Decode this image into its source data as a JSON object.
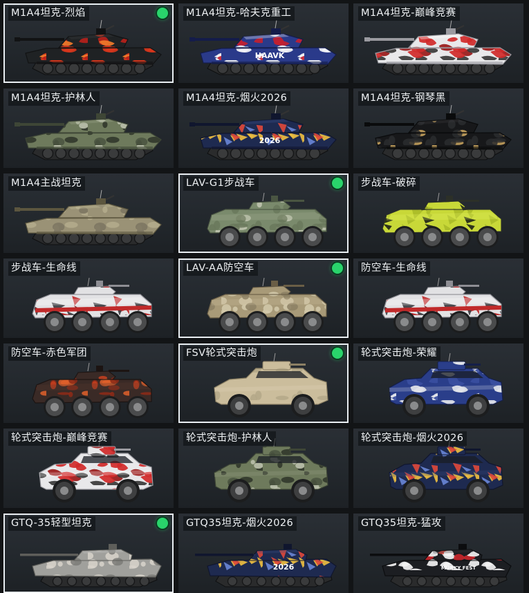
{
  "items": [
    {
      "label": "M1A4坦克-烈焰",
      "kind": "tank",
      "skin": "flame",
      "selected": true,
      "equipped": true
    },
    {
      "label": "M1A4坦克-哈夫克重工",
      "kind": "tank",
      "skin": "haavk",
      "selected": false,
      "equipped": false
    },
    {
      "label": "M1A4坦克-巅峰竞赛",
      "kind": "tank",
      "skin": "race",
      "selected": false,
      "equipped": false
    },
    {
      "label": "M1A4坦克-护林人",
      "kind": "tank",
      "skin": "forest",
      "selected": false,
      "equipped": false
    },
    {
      "label": "M1A4坦克-烟火2026",
      "kind": "tank",
      "skin": "fireworks",
      "selected": false,
      "equipped": false
    },
    {
      "label": "M1A4坦克-钢琴黑",
      "kind": "tank",
      "skin": "piano",
      "selected": false,
      "equipped": false
    },
    {
      "label": "M1A4主战坦克",
      "kind": "tank",
      "skin": "desert",
      "selected": false,
      "equipped": false
    },
    {
      "label": "LAV-G1步战车",
      "kind": "ifv",
      "skin": "green",
      "selected": true,
      "equipped": true
    },
    {
      "label": "步战车-破碎",
      "kind": "ifv",
      "skin": "shatter",
      "selected": false,
      "equipped": false
    },
    {
      "label": "步战车-生命线",
      "kind": "ifv",
      "skin": "lifeline",
      "selected": false,
      "equipped": false
    },
    {
      "label": "LAV-AA防空车",
      "kind": "ifv",
      "skin": "sand",
      "selected": true,
      "equipped": true
    },
    {
      "label": "防空车-生命线",
      "kind": "ifv",
      "skin": "lifeline",
      "selected": false,
      "equipped": false
    },
    {
      "label": "防空车-赤色军团",
      "kind": "ifv",
      "skin": "redlegion",
      "selected": false,
      "equipped": false
    },
    {
      "label": "FSV轮式突击炮",
      "kind": "fsv",
      "skin": "beige",
      "selected": true,
      "equipped": true
    },
    {
      "label": "轮式突击炮-荣耀",
      "kind": "fsv",
      "skin": "glory",
      "selected": false,
      "equipped": false
    },
    {
      "label": "轮式突击炮-巅峰竞赛",
      "kind": "fsv",
      "skin": "race",
      "selected": false,
      "equipped": false
    },
    {
      "label": "轮式突击炮-护林人",
      "kind": "fsv",
      "skin": "forest",
      "selected": false,
      "equipped": false
    },
    {
      "label": "轮式突击炮-烟火2026",
      "kind": "fsv",
      "skin": "fireworks",
      "selected": false,
      "equipped": false
    },
    {
      "label": "GTQ-35轻型坦克",
      "kind": "light",
      "skin": "grey",
      "selected": true,
      "equipped": true
    },
    {
      "label": "GTQ35坦克-烟火2026",
      "kind": "light",
      "skin": "fireworks",
      "selected": false,
      "equipped": false
    },
    {
      "label": "GTQ35坦克-猛攻",
      "kind": "light",
      "skin": "assault",
      "selected": false,
      "equipped": false
    }
  ],
  "decals": {
    "fireworks": "2026",
    "haavk": "HAAVK",
    "assault": "MURKY FEST"
  },
  "icons": {
    "equipped": "equipped-dot-icon"
  },
  "colors": {
    "background": "#121416",
    "card": "#262b30",
    "selected_border": "#e9eef2",
    "equipped_dot": "#29d46b",
    "label_text": "#eef1f3"
  }
}
